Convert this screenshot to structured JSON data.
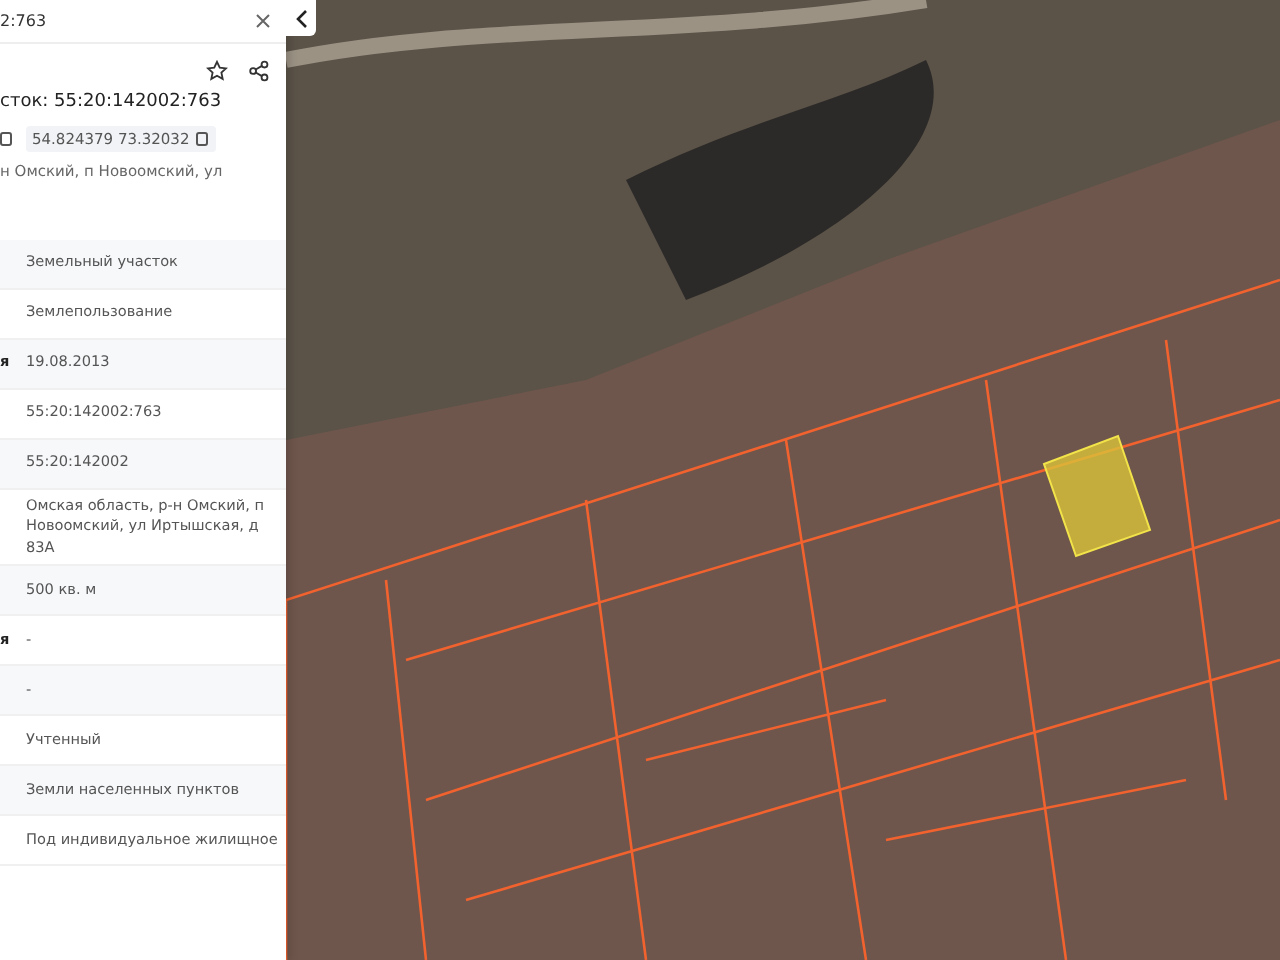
{
  "search": {
    "value": "2:763"
  },
  "title": "сток: 55:20:142002:763",
  "coordinates": [
    "54.824379 73.32032"
  ],
  "address": "н Омский, п Новоомский, ул",
  "attributes": [
    {
      "value": "Земельный участок"
    },
    {
      "value": "Землепользование"
    },
    {
      "label": "я",
      "value": "19.08.2013"
    },
    {
      "value": "55:20:142002:763"
    },
    {
      "value": "55:20:142002"
    },
    {
      "value": "Омская область, р-н Омский, п Новоомский, ул Иртышская, д 83А"
    },
    {
      "value": "500 кв. м"
    },
    {
      "label": "я",
      "value": "-"
    },
    {
      "value": "-"
    },
    {
      "value": "Учтенный"
    },
    {
      "value": "Земли населенных пунктов"
    },
    {
      "value": "Под индивидуальное жилищное"
    }
  ]
}
